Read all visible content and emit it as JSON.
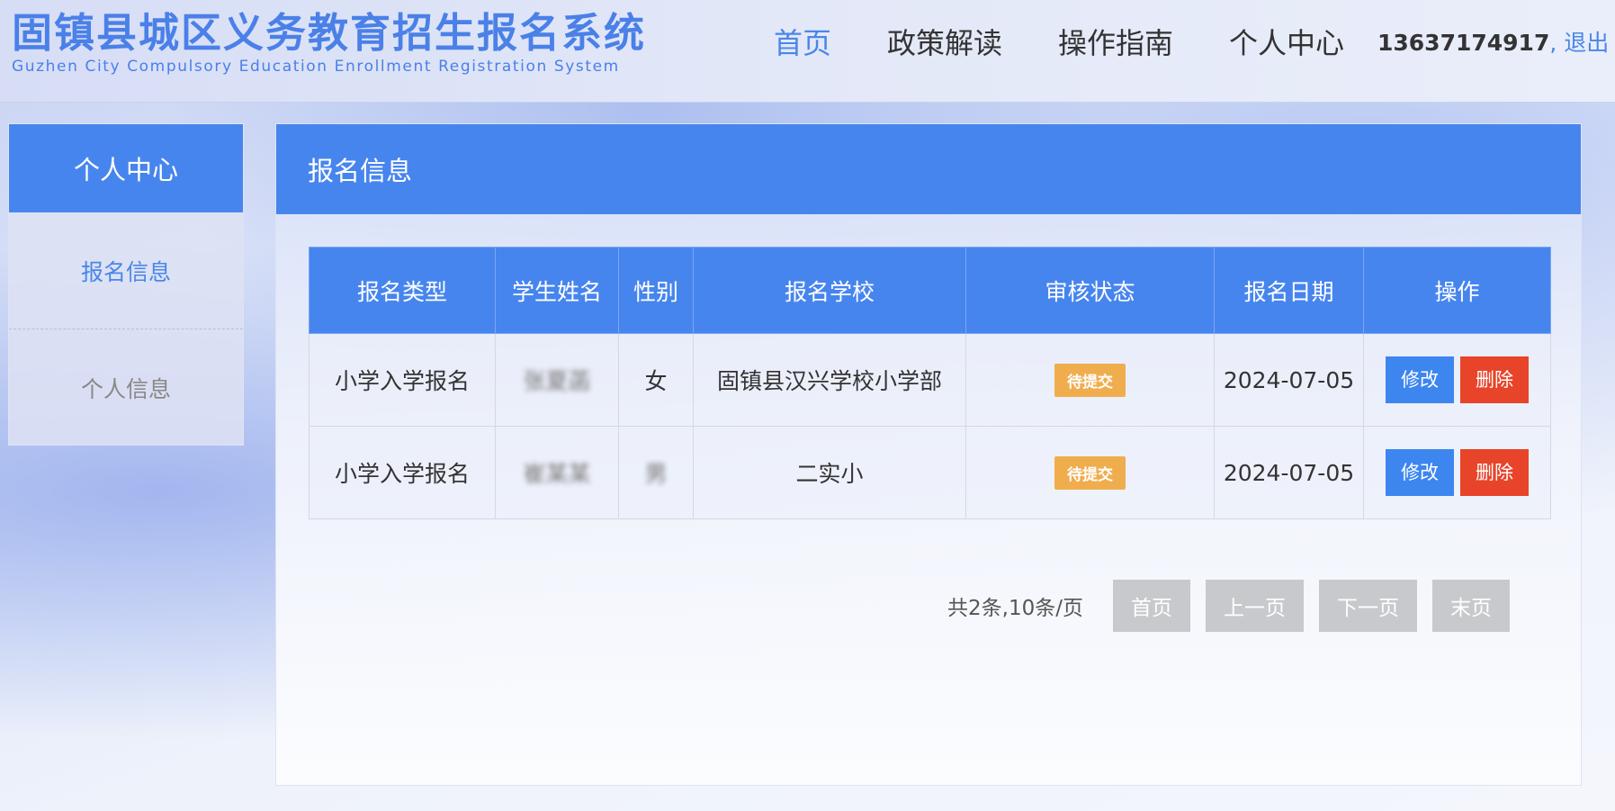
{
  "header": {
    "title": "固镇县城区义务教育招生报名系统",
    "subtitle": "Guzhen City Compulsory Education Enrollment Registration System",
    "nav": [
      {
        "label": "首页",
        "active": true
      },
      {
        "label": "政策解读",
        "active": false
      },
      {
        "label": "操作指南",
        "active": false
      },
      {
        "label": "个人中心",
        "active": false
      }
    ],
    "user_phone": "13637174917",
    "separator": ",",
    "logout_label": "退出"
  },
  "sidebar": {
    "title": "个人中心",
    "items": [
      {
        "label": "报名信息",
        "active": true
      },
      {
        "label": "个人信息",
        "active": false
      }
    ]
  },
  "main": {
    "title": "报名信息",
    "columns": [
      "报名类型",
      "学生姓名",
      "性别",
      "报名学校",
      "审核状态",
      "报名日期",
      "操作"
    ],
    "rows": [
      {
        "type": "小学入学报名",
        "name": "张夏菡",
        "gender": "女",
        "school": "固镇县汉兴学校小学部",
        "status": "待提交",
        "date": "2024-07-05"
      },
      {
        "type": "小学入学报名",
        "name": "崔某某",
        "gender": "男",
        "school": "二实小",
        "status": "待提交",
        "date": "2024-07-05"
      }
    ],
    "actions": {
      "edit_label": "修改",
      "delete_label": "删除"
    },
    "colors": {
      "primary": "#4785ee",
      "status": "#f0ad4e",
      "delete": "#e8442a"
    }
  },
  "pagination": {
    "summary": "共2条,10条/页",
    "first": "首页",
    "prev": "上一页",
    "next": "下一页",
    "last": "末页"
  }
}
